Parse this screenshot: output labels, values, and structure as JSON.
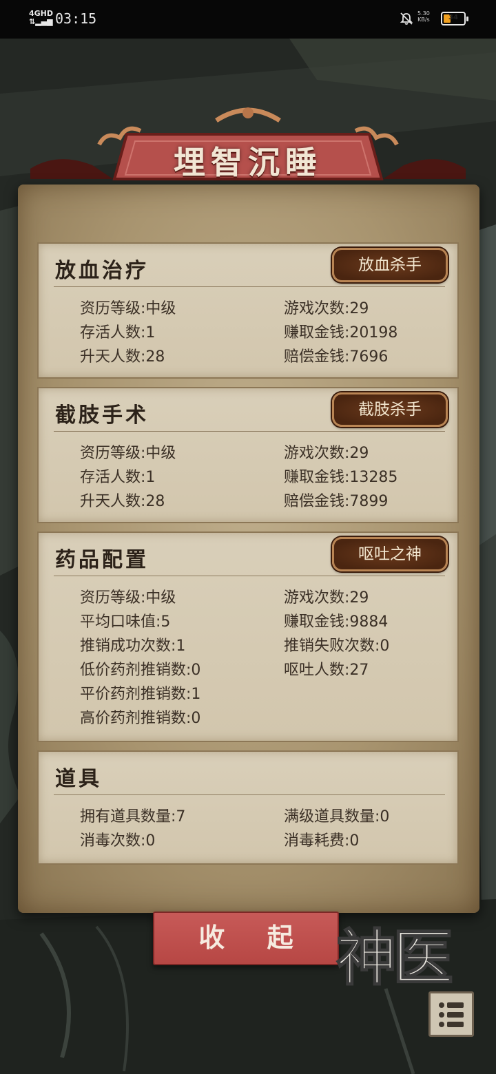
{
  "status_bar": {
    "network": "4GHD",
    "time": "03:15",
    "speed_value": "5.30",
    "speed_unit": "KB/s",
    "battery": "34",
    "battery_level": 0.34
  },
  "title": "埋智沉睡",
  "sections": [
    {
      "title": "放血治疗",
      "badge": "放血杀手",
      "stats_left": [
        {
          "label": "资历等级:",
          "value": "中级"
        },
        {
          "label": "存活人数:",
          "value": "1"
        },
        {
          "label": "升天人数:",
          "value": "28"
        }
      ],
      "stats_right": [
        {
          "label": "游戏次数:",
          "value": "29"
        },
        {
          "label": "赚取金钱:",
          "value": "20198"
        },
        {
          "label": "赔偿金钱:",
          "value": "7696"
        }
      ]
    },
    {
      "title": "截肢手术",
      "badge": "截肢杀手",
      "stats_left": [
        {
          "label": "资历等级:",
          "value": "中级"
        },
        {
          "label": "存活人数:",
          "value": "1"
        },
        {
          "label": "升天人数:",
          "value": "28"
        }
      ],
      "stats_right": [
        {
          "label": "游戏次数:",
          "value": "29"
        },
        {
          "label": "赚取金钱:",
          "value": "13285"
        },
        {
          "label": "赔偿金钱:",
          "value": "7899"
        }
      ]
    },
    {
      "title": "药品配置",
      "badge": "呕吐之神",
      "stats_left": [
        {
          "label": "资历等级:",
          "value": "中级"
        },
        {
          "label": "平均口味值:",
          "value": "5"
        },
        {
          "label": "推销成功次数:",
          "value": "1"
        },
        {
          "label": "低价药剂推销数:",
          "value": "0"
        },
        {
          "label": "平价药剂推销数:",
          "value": "1"
        },
        {
          "label": "高价药剂推销数:",
          "value": "0"
        }
      ],
      "stats_right": [
        {
          "label": "游戏次数:",
          "value": "29"
        },
        {
          "label": "赚取金钱:",
          "value": "9884"
        },
        {
          "label": "推销失败次数:",
          "value": "0"
        },
        {
          "label": "呕吐人数:",
          "value": "27"
        }
      ]
    },
    {
      "title": "道具",
      "stats_left": [
        {
          "label": "拥有道具数量:",
          "value": "7"
        },
        {
          "label": "消毒次数:",
          "value": "0"
        }
      ],
      "stats_right": [
        {
          "label": "满级道具数量:",
          "value": "0"
        },
        {
          "label": "消毒耗费:",
          "value": "0"
        }
      ]
    }
  ],
  "collapse_button": "收 起",
  "logo_text": "神医",
  "icons": {
    "mute": "bell-off-icon",
    "battery": "battery-icon",
    "menu": "list-menu-icon"
  },
  "colors": {
    "parchment": "#bfae8c",
    "card": "#d9cfb9",
    "banner": "#b5504c",
    "badge": "#5a2e14",
    "button": "#c75a58"
  }
}
